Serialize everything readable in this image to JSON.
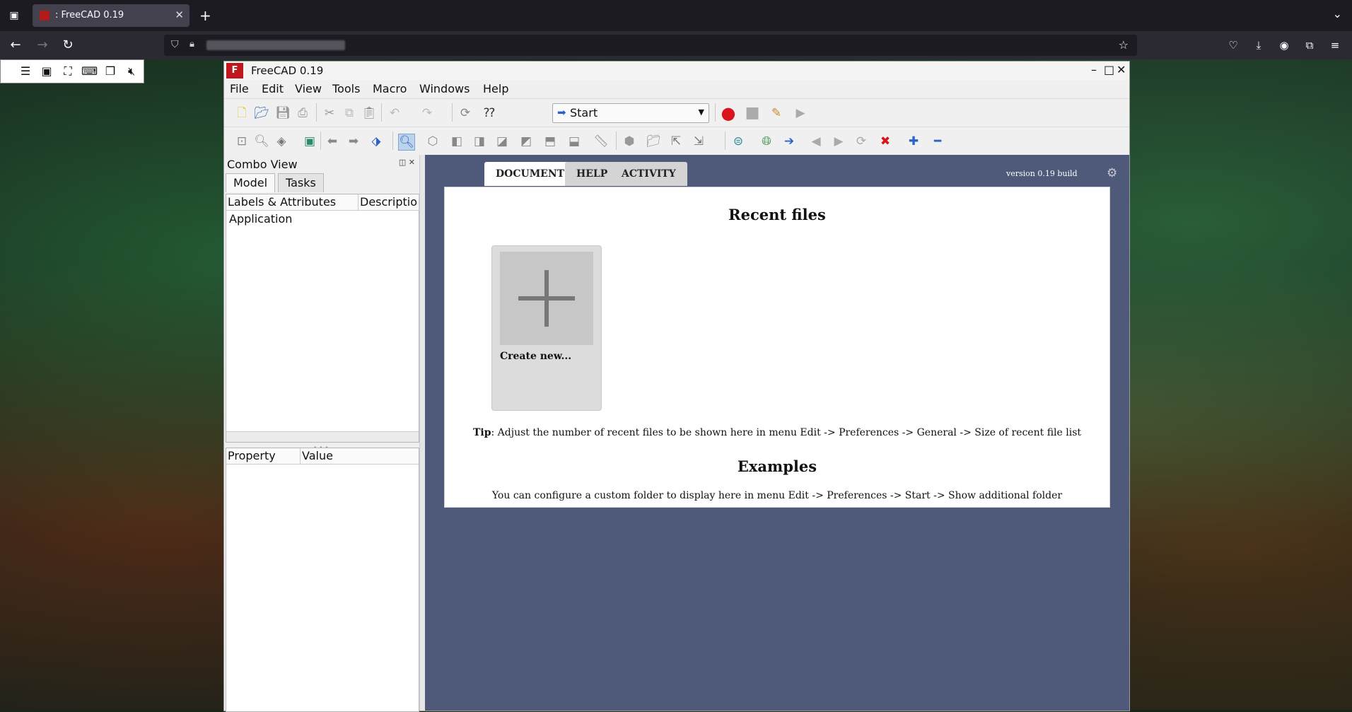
{
  "browser": {
    "tab_title": ": FreeCAD 0.19",
    "tab_close": "✕",
    "new_tab": "+",
    "list_all_tabs": "⌄"
  },
  "window": {
    "title": "FreeCAD 0.19",
    "logo_text": "F"
  },
  "menu": {
    "file": "File",
    "edit": "Edit",
    "view": "View",
    "tools": "Tools",
    "macro": "Macro",
    "windows": "Windows",
    "help": "Help"
  },
  "workbench": {
    "selected": "Start"
  },
  "combo": {
    "title": "Combo View",
    "tab_model": "Model",
    "tab_tasks": "Tasks",
    "col_labels": "Labels & Attributes",
    "col_description": "Descriptio",
    "root": "Application",
    "col_property": "Property",
    "col_value": "Value"
  },
  "start": {
    "tab_documents": "DOCUMENTS",
    "tab_help": "HELP",
    "tab_activity": "ACTIVITY",
    "version": "version 0.19 build",
    "recent_heading": "Recent files",
    "create_new": "Create new...",
    "tip_label": "Tip",
    "tip_text": ": Adjust the number of recent files to be shown here in menu Edit -> Preferences -> General -> Size of recent file list",
    "examples_heading": "Examples",
    "examples_note": "You can configure a custom folder to display here in menu Edit -> Preferences -> Start -> Show additional folder"
  },
  "colors": {
    "start_background": "#4f5a7a",
    "record_red": "#d9141c",
    "accent_blue": "#2a62c5"
  }
}
